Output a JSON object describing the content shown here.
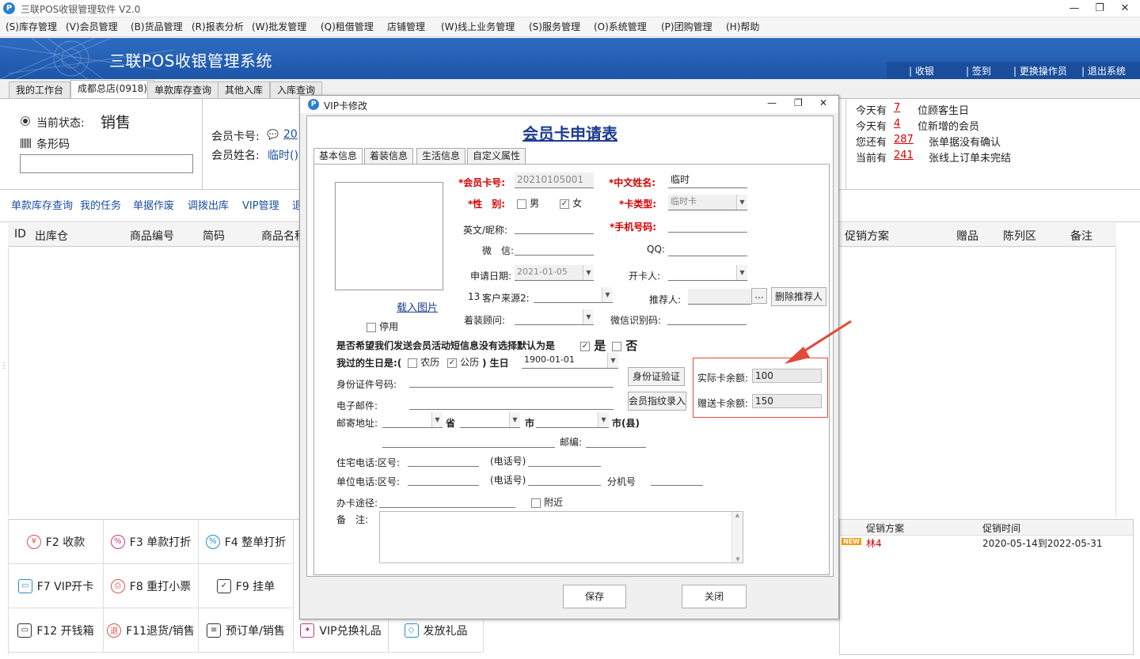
{
  "window": {
    "title": "三联POS收银管理软件 V2.0"
  },
  "menu": [
    "(S)库存管理",
    "(V)会员管理",
    "(B)货品管理",
    "(R)报表分析",
    "(W)批发管理",
    "(Q)租借管理",
    "店铺管理",
    "(W)线上业务管理",
    "(S)服务管理",
    "(O)系统管理",
    "(P)团购管理",
    "(H)帮助"
  ],
  "banner": {
    "title": "三联POS收银管理系统",
    "links": [
      "| 收银",
      "| 签到",
      "| 更换操作员",
      "| 退出系统"
    ]
  },
  "tabs": [
    "我的工作台",
    "成都总店(0918)",
    "单款库存查询",
    "其他入库",
    "入库查询"
  ],
  "status": {
    "label": "当前状态:",
    "value": "销售",
    "barcode_label": "条形码"
  },
  "member": {
    "card_label": "会员卡号:",
    "card_value": "20",
    "name_label": "会员姓名:",
    "name_value": "临时()"
  },
  "stats": [
    {
      "prefix": "今天有",
      "num": "7",
      "suffix": "位顾客生日"
    },
    {
      "prefix": "今天有",
      "num": "4",
      "suffix": "位新增的会员"
    },
    {
      "prefix": "您还有",
      "num": "287",
      "suffix": "张单据没有确认"
    },
    {
      "prefix": "当前有",
      "num": "241",
      "suffix": "张线上订单未完结"
    }
  ],
  "quicklinks": [
    "单款库存查询",
    "我的任务",
    "单据作废",
    "调拨出库",
    "VIP管理",
    "退"
  ],
  "grid_headers_left": [
    "ID",
    "出库仓",
    "商品编号",
    "简码",
    "商品名称"
  ],
  "grid_headers_right": [
    "促销方案",
    "赠品",
    "陈列区",
    "备注"
  ],
  "fkeys": [
    {
      "icon": "¥",
      "label": "F2 收款",
      "color": "#d9534f"
    },
    {
      "icon": "%",
      "label": "F3 单款打折",
      "color": "#c0398a"
    },
    {
      "icon": "%",
      "label": "F4 整单打折",
      "color": "#2a8ac9"
    },
    {
      "icon": "▭",
      "label": "F7 VIP开卡",
      "color": "#2a8ac9"
    },
    {
      "icon": "⎙",
      "label": "F8 重打小票",
      "color": "#d9534f"
    },
    {
      "icon": "✓",
      "label": "F9 挂单",
      "color": "#333"
    },
    {
      "icon": "▭",
      "label": "F12 开钱箱",
      "color": "#333"
    },
    {
      "icon": "退",
      "label": "F11退货/销售",
      "color": "#d9534f"
    },
    {
      "icon": "≡",
      "label": "预订单/销售",
      "color": "#333"
    },
    {
      "icon": "✦",
      "label": "VIP兑换礼品",
      "color": "#c0398a"
    },
    {
      "icon": "◇",
      "label": "发放礼品",
      "color": "#2a8ac9"
    }
  ],
  "promo": {
    "headers": [
      "促销方案",
      "促销时间"
    ],
    "row": {
      "badge": "NEW",
      "name": "林4",
      "period": "2020-05-14到2022-05-31"
    }
  },
  "dialog": {
    "title": "VIP卡修改",
    "form_title": "会员卡申请表",
    "tabs": [
      "基本信息",
      "着装信息",
      "生活信息",
      "自定义属性"
    ],
    "load_image": "载入图片",
    "disable": "停用",
    "fields": {
      "card_no_label": "*会员卡号:",
      "card_no": "20210105001",
      "cn_name_label": "*中文姓名:",
      "cn_name": "临时",
      "gender_label": "*性　别:",
      "male": "男",
      "female": "女",
      "card_type_label": "*卡类型:",
      "card_type": "临时卡",
      "nickname_label": "英文/昵称:",
      "phone_label": "*手机号码:",
      "wechat_label": "微　信:",
      "qq_label": "QQ:",
      "apply_date_label": "申请日期:",
      "apply_date": "2021-01-05",
      "opener_label": "开卡人:",
      "source_prefix": "13",
      "source_label": "客户来源2:",
      "referrer_label": "推荐人:",
      "referrer_btn": "...",
      "remove_referrer": "删除推荐人",
      "advisor_label": "着装顾问:",
      "wechat_id_label": "微信识别码:",
      "sms_question": "是否希望我们发送会员活动短信息没有选择默认为是",
      "yes": "是",
      "no": "否",
      "birthday_prefix": "我过的生日是:(",
      "lunar": "农历",
      "solar": "公历",
      "birthday_suffix": ")  生日",
      "birthday": "1900-01-01",
      "id_label": "身份证件号码:",
      "id_verify": "身份证验证",
      "email_label": "电子邮件:",
      "fingerprint": "会员指纹录入",
      "address_label": "邮寄地址:",
      "province": "省",
      "city": "市",
      "county": "市(县)",
      "zip_label": "邮编:",
      "home_phone_label": "住宅电话:区号:",
      "phone_no": "(电话号)",
      "work_phone_label": "单位电话:区号:",
      "ext_label": "分机号",
      "channel_label": "办卡途径:",
      "nearby": "附近",
      "remark_label": "备　注:",
      "actual_balance_label": "实际卡余额:",
      "actual_balance": "100",
      "gift_balance_label": "赠送卡余额:",
      "gift_balance": "150"
    },
    "save": "保存",
    "close": "关闭"
  }
}
